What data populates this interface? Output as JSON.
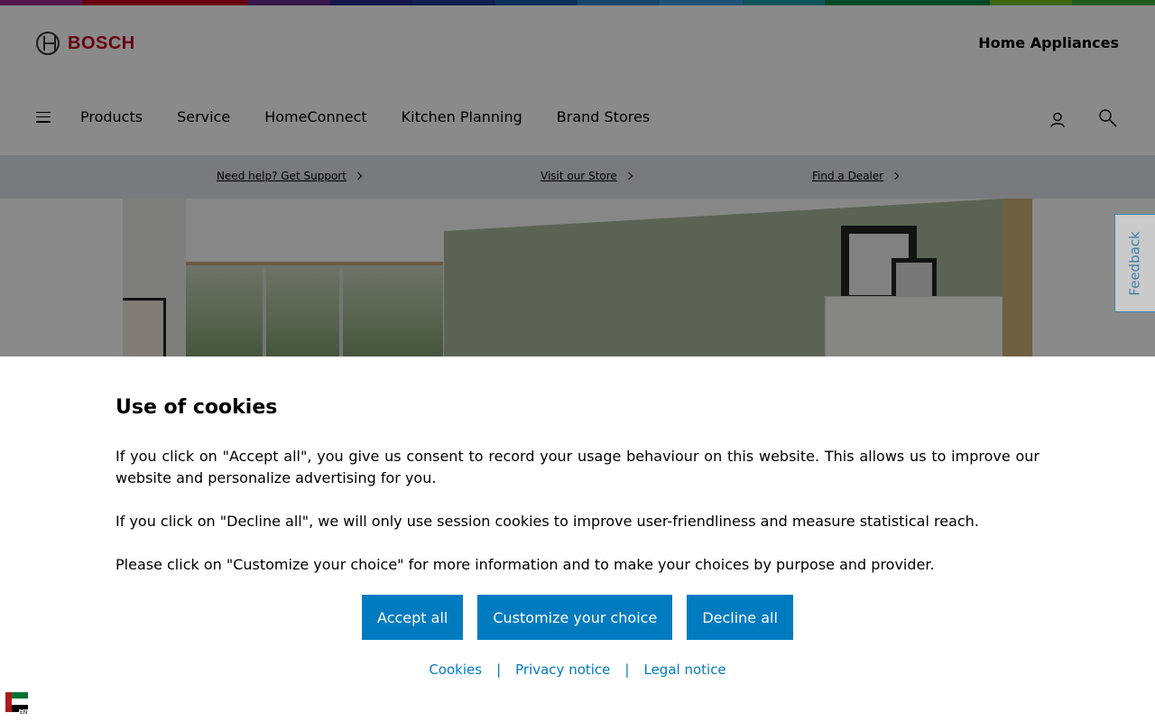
{
  "colors": {
    "accent": "#007bc0",
    "rainbow": [
      "#9e2896",
      "#c1001f",
      "#c1001f",
      "#6a2a8c",
      "#2a2a8c",
      "#1f3a8c",
      "#1d5aa8",
      "#2882c8",
      "#3a9ad8",
      "#18a0a8",
      "#00884a",
      "#00884a",
      "#78be20",
      "#3caa3c"
    ]
  },
  "header": {
    "logo_text": "BOSCH",
    "brand_title": "Home Appliances"
  },
  "nav": {
    "items": [
      "Products",
      "Service",
      "HomeConnect",
      "Kitchen Planning",
      "Brand Stores"
    ]
  },
  "supportbar": {
    "links": [
      "Need help? Get Support",
      "Visit our Store",
      "Find a Dealer"
    ]
  },
  "feedback": {
    "label": "Feedback"
  },
  "cookie": {
    "title": "Use of cookies",
    "paragraphs": [
      "If you click on \"Accept all\", you give us consent to record your usage behaviour on this website. This allows us to improve our website and personalize advertising for you.",
      "If you click on \"Decline all\", we will only use session cookies to improve user-friendliness and measure statistical reach.",
      "Please click on \"Customize your choice\" for more information and to make your choices by purpose and provider."
    ],
    "buttons": [
      "Accept all",
      "Customize your choice",
      "Decline all"
    ],
    "links": [
      "Cookies",
      "Privacy notice",
      "Legal notice"
    ],
    "separator": "|"
  },
  "locale": {
    "code": "EN"
  }
}
